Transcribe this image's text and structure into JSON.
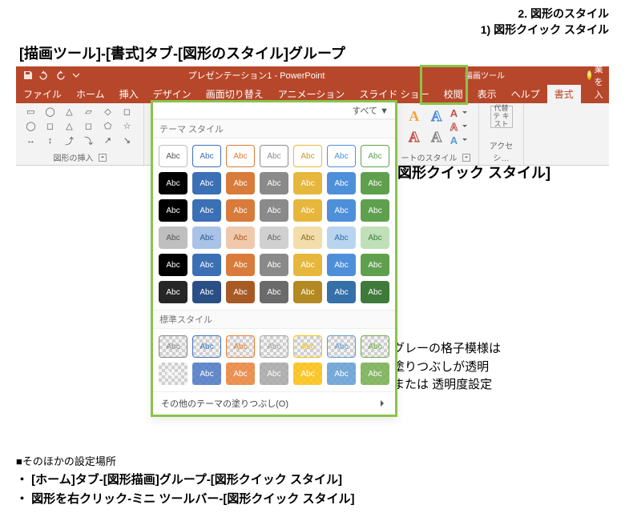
{
  "header_right": {
    "line1": "2. 図形のスタイル",
    "line2": "1) 図形クイック スタイル"
  },
  "header_main": "[描画ツール]-[書式]タブ-[図形のスタイル]グループ",
  "titlebar": {
    "doc": "プレゼンテーション1 - PowerPoint",
    "context_tool": "描画ツール"
  },
  "tabs": [
    "ファイル",
    "ホーム",
    "挿入",
    "デザイン",
    "画面切り替え",
    "アニメーション",
    "スライド ショー",
    "校閲",
    "表示",
    "ヘルプ",
    "書式"
  ],
  "active_tab_index": 10,
  "tell_me": "作業を入",
  "groups": {
    "shapes": {
      "label": "図形の挿入"
    },
    "shape_styles": {
      "label": "ートのスタイル"
    },
    "wordart": {
      "label": ""
    },
    "fill": {
      "fill": "",
      "outline": "",
      "effects": ""
    },
    "acc": {
      "label": "アクセシ…",
      "alt": "代替テ\nキスト"
    }
  },
  "gallery": {
    "all_label": "すべて ▼",
    "section_theme": "テーマ スタイル",
    "section_standard": "標準スタイル",
    "swatch_text": "Abc",
    "footer": "その他のテーマの塗りつぶし(O)",
    "theme_palette": [
      "#000000",
      "#3b6fb6",
      "#d97b3a",
      "#8a8a8a",
      "#e6b73c",
      "#4e8fd9",
      "#5fa04e"
    ],
    "outline_row_border": [
      "#bdbdbd",
      "#3b6fb6",
      "#d97b3a",
      "#8a8a8a",
      "#e6b73c",
      "#4e8fd9",
      "#5fa04e"
    ],
    "outline_row_text": [
      "#555",
      "#3b6fb6",
      "#d97b3a",
      "#8a8a8a",
      "#c79a1f",
      "#4e8fd9",
      "#5fa04e"
    ],
    "solid_rows_text": "#ffffff",
    "tint_row_bg": [
      "#bfbfbf",
      "#a9c3e6",
      "#f0c9ad",
      "#d0d0d0",
      "#f3ddaa",
      "#b8d4ef",
      "#bfe0b8"
    ],
    "tint_row_text": [
      "#555",
      "#2e5792",
      "#a85a25",
      "#666",
      "#8a6d1f",
      "#2e6da8",
      "#3e7a3a"
    ],
    "darker_row_bg": [
      "#262626",
      "#2a4f85",
      "#a85a25",
      "#6b6b6b",
      "#b38a22",
      "#3670a8",
      "#3e7a3a"
    ],
    "standard_outline_colors": [
      "#888",
      "#4472c4",
      "#ed7d31",
      "#a5a5a5",
      "#ffc000",
      "#5b9bd5",
      "#70ad47"
    ],
    "standard_solid_colors": [
      "#888",
      "#4472c4",
      "#ed7d31",
      "#a5a5a5",
      "#ffc000",
      "#5b9bd5",
      "#70ad47"
    ]
  },
  "side_label": "[図形クイック スタイル]",
  "side_note": {
    "l1": "グレーの格子模様は",
    "l2": "塗りつぶしが透明",
    "l3": "または 透明度設定"
  },
  "footer": {
    "heading": "■そのほかの設定場所",
    "items": [
      "[ホーム]タブ-[図形描画]グループ-[図形クイック スタイル]",
      "図形を右クリック-ミニ ツールバー-[図形クイック スタイル]"
    ]
  },
  "wordart_colors": {
    "fill": "#f2a23c",
    "outline_blue": "#4e8fd9",
    "outline_red": "#c0504d",
    "outline_gray": "#888"
  }
}
